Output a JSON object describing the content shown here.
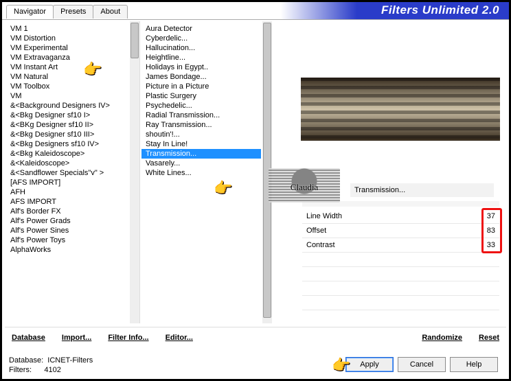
{
  "app_title": "Filters Unlimited 2.0",
  "tabs": [
    "Navigator",
    "Presets",
    "About"
  ],
  "categories": [
    "VM 1",
    "VM Distortion",
    "VM Experimental",
    "VM Extravaganza",
    "VM Instant Art",
    "VM Natural",
    "VM Toolbox",
    "VM",
    "&<Background Designers IV>",
    "&<Bkg Designer sf10 I>",
    "&<BKg Designer sf10 II>",
    "&<Bkg Designer sf10 III>",
    "&<Bkg Designers sf10 IV>",
    "&<Bkg Kaleidoscope>",
    "&<Kaleidoscope>",
    "&<Sandflower Specials\"v\" >",
    "[AFS IMPORT]",
    "AFH",
    "AFS IMPORT",
    "Alf's Border FX",
    "Alf's Power Grads",
    "Alf's Power Sines",
    "Alf's Power Toys",
    "AlphaWorks"
  ],
  "filters": [
    "Aura Detector",
    "Cyberdelic...",
    "Hallucination...",
    "Heightline...",
    "Holidays in Egypt..",
    "James Bondage...",
    "Picture in a Picture",
    "Plastic Surgery",
    "Psychedelic...",
    "Radial Transmission...",
    "Ray Transmission...",
    "shoutin'!...",
    "Stay In Line!",
    "Transmission...",
    "Vasarely...",
    "White Lines..."
  ],
  "current_filter": "Transmission...",
  "params": [
    {
      "label": "Line Width",
      "value": 37
    },
    {
      "label": "Offset",
      "value": 83
    },
    {
      "label": "Contrast",
      "value": 33
    }
  ],
  "bottom_links": [
    "Database",
    "Import...",
    "Filter Info...",
    "Editor...",
    "Randomize",
    "Reset"
  ],
  "status": {
    "db_label": "Database:",
    "db_value": "ICNET-Filters",
    "filters_label": "Filters:",
    "filters_value": "4102"
  },
  "buttons": {
    "apply": "Apply",
    "cancel": "Cancel",
    "help": "Help"
  },
  "watermark": "Claudia"
}
